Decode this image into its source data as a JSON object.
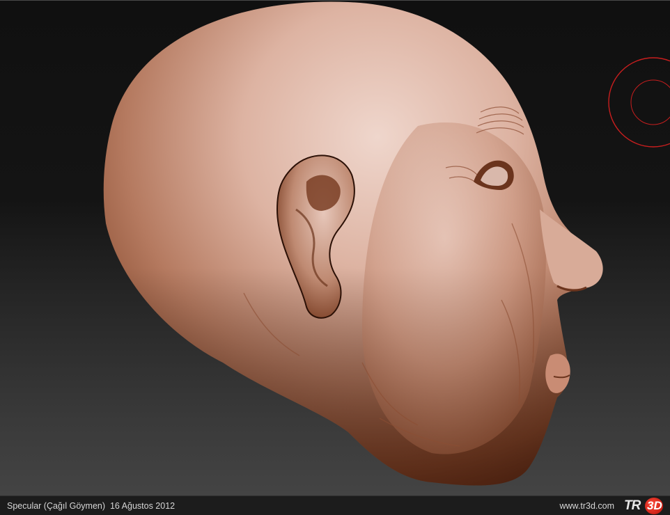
{
  "footer": {
    "credit": "Specular (Çağıl Göymen)  16 Ağustos 2012",
    "site": "www.tr3d.com",
    "logo": {
      "prefix": "TR",
      "badge": "3D"
    }
  },
  "viewport": {
    "subject": "sculpted-head",
    "brush_cursor_color": "#c81e1e"
  },
  "colors": {
    "skin_light": "#e6c2b4",
    "skin_mid": "#b98068",
    "skin_dark": "#6b3620",
    "background_top": "#101010",
    "background_bottom": "#444444"
  }
}
